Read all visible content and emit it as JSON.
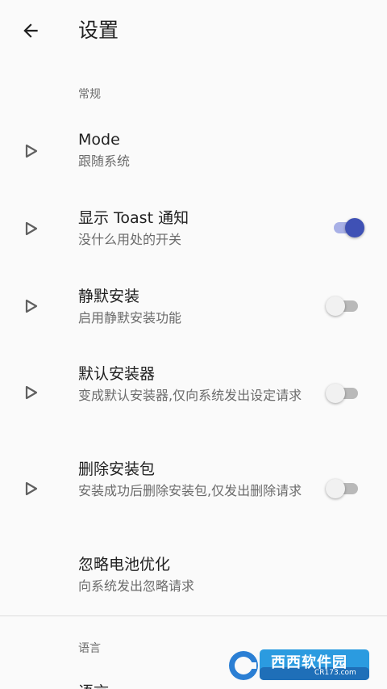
{
  "appbar": {
    "title": "设置"
  },
  "sections": [
    {
      "header": "常规"
    },
    {
      "header": "语言"
    }
  ],
  "prefs": [
    {
      "title": "Mode",
      "summary": "跟随系统",
      "has_switch": false
    },
    {
      "title": "显示 Toast 通知",
      "summary": "没什么用处的开关",
      "has_switch": true,
      "switch_on": true
    },
    {
      "title": "静默安装",
      "summary": "启用静默安装功能",
      "has_switch": true,
      "switch_on": false
    },
    {
      "title": "默认安装器",
      "summary": "变成默认安装器,仅向系统发出设定请求",
      "has_switch": true,
      "switch_on": false
    },
    {
      "title": "删除安装包",
      "summary": "安装成功后删除安装包,仅发出删除请求",
      "has_switch": true,
      "switch_on": false
    },
    {
      "title": "忽略电池优化",
      "summary": "向系统发出忽略请求",
      "has_switch": false
    },
    {
      "title": "语言",
      "summary": "",
      "has_switch": false
    }
  ],
  "colors": {
    "accent": "#3f51b5",
    "accent_track": "#a8b0e6",
    "switch_off_track": "#b9b9b9",
    "background": "#fafafa"
  },
  "icons": {
    "back": "arrow-back-icon",
    "pref": "play-arrow-outline-icon"
  },
  "watermark": {
    "brand": "西西软件园",
    "url": "CR173.com"
  }
}
